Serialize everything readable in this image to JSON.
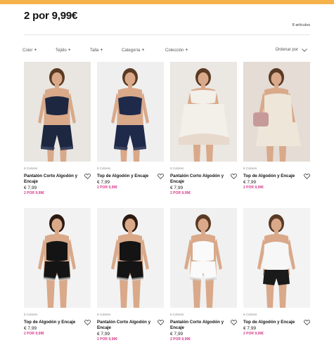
{
  "page": {
    "title": "2 por 9,99€",
    "count": "8 artículos",
    "accent": "#f5b24a",
    "promo_color": "#d63a8a"
  },
  "filters": [
    {
      "label": "Color",
      "icon": "plus-icon"
    },
    {
      "label": "Tejido",
      "icon": "plus-icon"
    },
    {
      "label": "Talla",
      "icon": "plus-icon"
    },
    {
      "label": "Categoría",
      "icon": "plus-icon"
    },
    {
      "label": "Colección",
      "icon": "plus-icon"
    }
  ],
  "sort": {
    "label": "Ordenar por",
    "icon": "chevron-down-icon"
  },
  "products": [
    {
      "colors": "6 Colores",
      "name": "Pantalón Corto Algodón y Encaje",
      "price": "€ 7,99",
      "promo": "2 POR 9,99€",
      "garment": "#1d2740",
      "garment_style": "top-shorts"
    },
    {
      "colors": "6 Colores",
      "name": "Top de Algodón y Encaje",
      "price": "€ 7,99",
      "promo": "2 POR 9,99€",
      "garment": "#1f2a4a",
      "garment_style": "top-shorts"
    },
    {
      "colors": "6 Colores",
      "name": "Pantalón Corto Algodón y Encaje",
      "price": "€ 7,99",
      "promo": "2 POR 9,99€",
      "garment": "#f3efe9",
      "garment_style": "shorts-only"
    },
    {
      "colors": "6 Colores",
      "name": "Top de Algodón y Encaje",
      "price": "€ 7,99",
      "promo": "2 POR 9,99€",
      "garment": "#eee6d8",
      "garment_style": "seated"
    },
    {
      "colors": "6 Colores",
      "name": "Top de Algodón y Encaje",
      "price": "€ 7,99",
      "promo": "2 POR 9,99€",
      "garment": "#141414",
      "garment_style": "full"
    },
    {
      "colors": "6 Colores",
      "name": "Pantalón Corto Algodón y Encaje",
      "price": "€ 7,99",
      "promo": "2 POR 9,99€",
      "garment": "#141414",
      "garment_style": "full"
    },
    {
      "colors": "6 Colores",
      "name": "Pantalón Corto Algodón y Encaje",
      "price": "€ 7,99",
      "promo": "2 POR 9,99€",
      "garment": "#fafafa",
      "garment_style": "full"
    },
    {
      "colors": "6 Colores",
      "name": "Top de Algodón y Encaje",
      "price": "€ 7,99",
      "promo": "2 POR 9,99€",
      "garment": "#f7f7f7",
      "garment_style": "top-black-shorts"
    }
  ]
}
